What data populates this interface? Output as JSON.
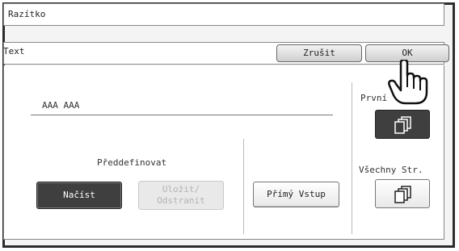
{
  "title_bar": {
    "title": "Razítko"
  },
  "sub_bar": {
    "label": "Text",
    "cancel_label": "Zrušit",
    "ok_label": "OK"
  },
  "text_field": {
    "value": "AAA AAA"
  },
  "predefined": {
    "heading": "Předdefinovat",
    "load_label": "Načíst",
    "save_delete_line1": "Uložit/",
    "save_delete_line2": "Odstranit"
  },
  "direct_input": {
    "label": "Přímý Vstup"
  },
  "pages": {
    "first_label": "První",
    "all_label": "Všechny Str."
  },
  "icons": {
    "pages_first": "pages-stack-icon",
    "pages_all": "pages-stack-icon",
    "pointer": "hand-pointer-icon"
  },
  "colors": {
    "selected": "#3f3f3f",
    "frame": "#2c2c2c"
  }
}
